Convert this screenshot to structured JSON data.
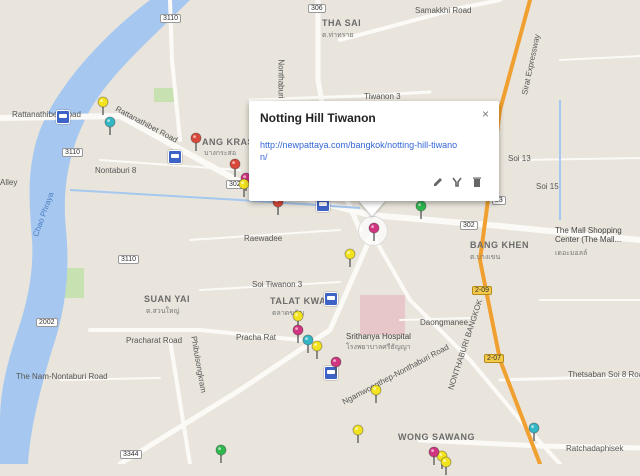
{
  "info_window": {
    "title": "Notting Hill Tiwanon",
    "link": "http://newpattaya.com/bangkok/notting-hill-tiwanon/",
    "close_glyph": "×",
    "tools": [
      "pencil-icon",
      "style-icon",
      "trash-icon"
    ]
  },
  "road_labels": {
    "rattanathibet_road_a": "Rattanathibet Road",
    "rattanathibet_road_b": "Rattanathibet Road",
    "nontaburi_8": "Nontaburi 8",
    "samakkhi_road": "Samakkhi Road",
    "tiwanon_3": "Tiwanon 3",
    "soi_13": "Soi 13",
    "soi_15": "Soi 15",
    "raewadee": "Raewadee",
    "soi_tiwanon_3": "Soi Tiwanon 3",
    "pracha_rat": "Pracharat Road",
    "pracha_rat_2": "Pracha Rat",
    "phibulsongkram": "Phibulsongkram",
    "the_nam_nontaburi": "The Nam-Nontaburi Road",
    "ngamwongwan": "Ngamwongwan",
    "daongmanee": "Daongmanee",
    "thetsaban_soi": "Thetsaban Soi 8 Road",
    "ratchadaphisek": "Ratchadaphisek",
    "sirat_expressway": "Sirat Expressway",
    "bangthep_nontaburi": "Ngamwongthep-Nonthaburi Road",
    "alley": "Alley",
    "nonthaburi_46": "Nonthaburi 46",
    "chao_phraya": "Chao Phraya"
  },
  "area_labels": {
    "tha_sai": "THA SAI",
    "bang_kraso": "ANG KRASO",
    "bang_khen": "BANG KHEN",
    "suan_yai": "SUAN YAI",
    "talat_kwan": "TALAT KWAN",
    "wong_sawang": "WONG SAWANG",
    "nonthaburi_bangkok": "NONTHABURI BANGKOK"
  },
  "place_labels": {
    "mall": "The Mall Shopping Center (The Mall...",
    "hospital": "Srithanya Hospital"
  },
  "thai_labels": {
    "tha_sai": "ต.ท่าทราย",
    "bang_kraso": "บางกระสอ",
    "bang_khen": "ต.บางเขน",
    "suan_yai": "ต.สวนใหญ่",
    "talat_kwan": "ตลาดขวัญ",
    "hospital": "โรงพยาบาลศรีธัญญา",
    "mall": "เดอะมอลล์"
  },
  "route_shields": {
    "r3110_top": "3110",
    "r306": "306",
    "r3110_left": "3110",
    "r302_a": "302",
    "r302_b": "302",
    "r2002": "2002",
    "r3344": "3344",
    "r2_09": "2-09",
    "r2_07": "2-07",
    "r23": "23"
  },
  "colors": {
    "water": "#a6c8f0",
    "land": "#e9e5dc",
    "park": "#c8e1b0",
    "minor_road": "#ffffff",
    "major_road": "#fbfaf7",
    "expressway": "#f0a030",
    "pin_yellow": "#f3e31e",
    "pin_red": "#d9483b",
    "pin_pink": "#d03580",
    "pin_teal": "#35b6c4",
    "pin_green": "#2eb84f",
    "transit": "#3e63c6"
  },
  "pins": [
    {
      "name": "pin-yellow-1",
      "color": "pin_yellow"
    },
    {
      "name": "pin-teal-1",
      "color": "pin_teal"
    },
    {
      "name": "pin-red-1",
      "color": "pin_red"
    },
    {
      "name": "pin-red-2",
      "color": "pin_red"
    },
    {
      "name": "pin-pink-1",
      "color": "pin_pink"
    },
    {
      "name": "pin-yellow-2",
      "color": "pin_yellow"
    },
    {
      "name": "pin-pink-selected",
      "color": "pin_pink"
    },
    {
      "name": "pin-green-1",
      "color": "pin_green"
    },
    {
      "name": "pin-yellow-3",
      "color": "pin_yellow"
    },
    {
      "name": "pin-yellow-4",
      "color": "pin_yellow"
    },
    {
      "name": "pin-pink-2",
      "color": "pin_pink"
    },
    {
      "name": "pin-teal-2",
      "color": "pin_teal"
    },
    {
      "name": "pin-yellow-5",
      "color": "pin_yellow"
    },
    {
      "name": "pin-pink-3",
      "color": "pin_pink"
    },
    {
      "name": "pin-yellow-6",
      "color": "pin_yellow"
    },
    {
      "name": "pin-yellow-7",
      "color": "pin_yellow"
    },
    {
      "name": "pin-green-2",
      "color": "pin_green"
    },
    {
      "name": "pin-yellow-8",
      "color": "pin_yellow"
    },
    {
      "name": "pin-pink-4",
      "color": "pin_pink"
    },
    {
      "name": "pin-yellow-9",
      "color": "pin_yellow"
    },
    {
      "name": "pin-teal-3",
      "color": "pin_teal"
    },
    {
      "name": "pin-red-3",
      "color": "pin_red"
    }
  ]
}
